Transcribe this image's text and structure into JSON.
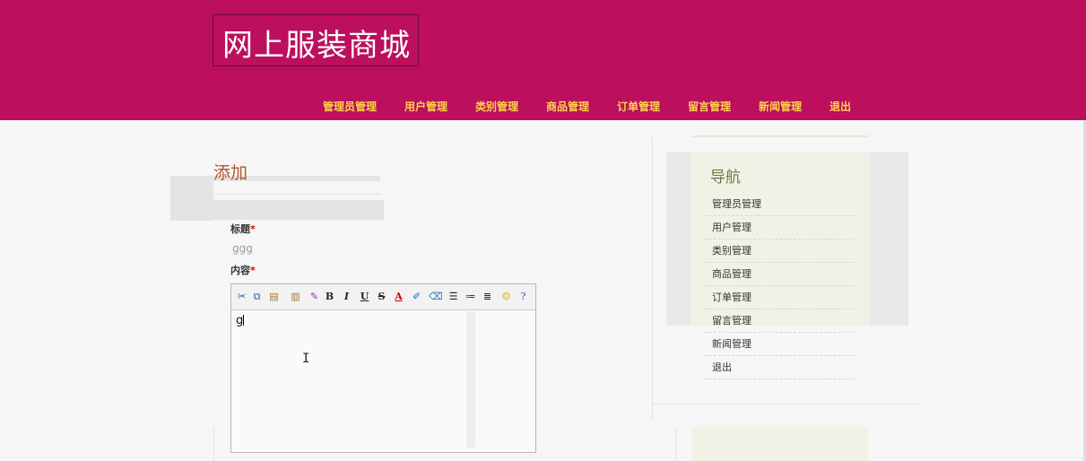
{
  "site": {
    "title": "网上服装商城"
  },
  "nav": {
    "items": [
      "管理员管理",
      "用户管理",
      "类别管理",
      "商品管理",
      "订单管理",
      "留言管理",
      "新闻管理",
      "退出"
    ]
  },
  "form": {
    "heading": "添加",
    "title_label": "标题",
    "title_value": "ggg",
    "content_label": "内容",
    "required_mark": "*",
    "editor": {
      "content": "g",
      "toolbar": [
        "cut-icon",
        "copy-icon",
        "paste-icon",
        "paste-text-icon",
        "paste-word-icon",
        "bold-icon",
        "italic-icon",
        "underline-icon",
        "strikethrough-icon",
        "font-color-icon",
        "highlight-icon",
        "remove-format-icon",
        "align-icon",
        "bulleted-list-icon",
        "numbered-list-icon",
        "emoticon-icon",
        "help-icon"
      ]
    }
  },
  "sidebar": {
    "title": "导航",
    "items": [
      "管理员管理",
      "用户管理",
      "类别管理",
      "商品管理",
      "订单管理",
      "留言管理",
      "新闻管理",
      "退出"
    ]
  },
  "colors": {
    "header_bg": "#bc0f5e",
    "nav_text": "#ffd24a",
    "heading": "#b5552a",
    "sidebar_title": "#6d7a3e"
  }
}
